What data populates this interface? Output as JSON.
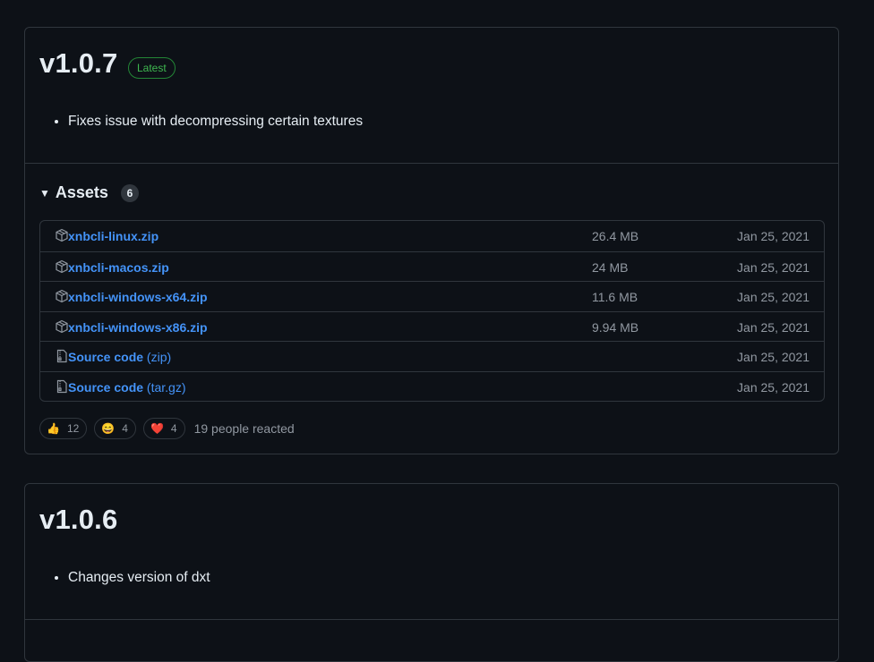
{
  "releases": [
    {
      "version": "v1.0.7",
      "badge": "Latest",
      "notes": [
        "Fixes issue with decompressing certain textures"
      ],
      "assets_title": "Assets",
      "assets_count": "6",
      "assets": [
        {
          "name": "xnbcli-linux.zip",
          "ext": "",
          "size": "26.4 MB",
          "date": "Jan 25, 2021",
          "icon": "package-icon"
        },
        {
          "name": "xnbcli-macos.zip",
          "ext": "",
          "size": "24 MB",
          "date": "Jan 25, 2021",
          "icon": "package-icon"
        },
        {
          "name": "xnbcli-windows-x64.zip",
          "ext": "",
          "size": "11.6 MB",
          "date": "Jan 25, 2021",
          "icon": "package-icon"
        },
        {
          "name": "xnbcli-windows-x86.zip",
          "ext": "",
          "size": "9.94 MB",
          "date": "Jan 25, 2021",
          "icon": "package-icon"
        },
        {
          "name": "Source code",
          "ext": "(zip)",
          "size": "",
          "date": "Jan 25, 2021",
          "icon": "file-zip-icon"
        },
        {
          "name": "Source code",
          "ext": "(tar.gz)",
          "size": "",
          "date": "Jan 25, 2021",
          "icon": "file-zip-icon"
        }
      ],
      "reactions": [
        {
          "emoji": "👍",
          "count": "12"
        },
        {
          "emoji": "😄",
          "count": "4"
        },
        {
          "emoji": "❤️",
          "count": "4"
        }
      ],
      "reactions_text": "19 people reacted"
    },
    {
      "version": "v1.0.6",
      "notes": [
        "Changes version of dxt"
      ]
    }
  ],
  "colors": {
    "background": "#0d1117",
    "border": "#30363d",
    "link": "#4493f8",
    "muted": "#9198a1",
    "latest_green": "#3fb950"
  }
}
